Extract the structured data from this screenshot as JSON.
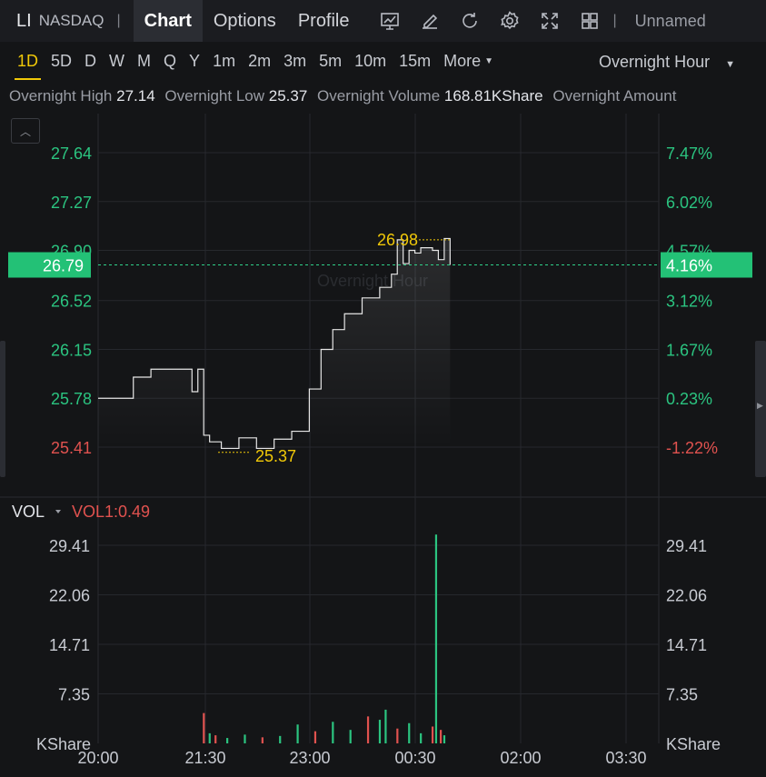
{
  "header": {
    "symbol": "LI",
    "exchange": "NASDAQ",
    "separator": "|",
    "tabs": [
      {
        "label": "Chart",
        "active": true
      },
      {
        "label": "Options",
        "active": false
      },
      {
        "label": "Profile",
        "active": false
      }
    ],
    "icons": [
      "chart-type-icon",
      "draw-pencil-icon",
      "refresh-icon",
      "settings-gear-icon",
      "fullscreen-icon",
      "layout-grid-icon"
    ],
    "layout_name": "Unnamed"
  },
  "periods": {
    "items": [
      "1D",
      "5D",
      "D",
      "W",
      "M",
      "Q",
      "Y",
      "1m",
      "2m",
      "3m",
      "5m",
      "10m",
      "15m",
      "More"
    ],
    "active": "1D",
    "session": "Overnight Hour"
  },
  "stats": {
    "high_label": "Overnight High",
    "high_value": "27.14",
    "low_label": "Overnight Low",
    "low_value": "25.37",
    "volume_label": "Overnight Volume",
    "volume_value": "168.81KShare",
    "amount_label": "Overnight Amount"
  },
  "watermark": "Overnight Hour",
  "colors": {
    "up": "#2bc480",
    "down": "#e0524f",
    "accent": "#f0c808",
    "current_price_bg": "#23c176",
    "price_line": "#e6e6e6"
  },
  "chart_data": [
    {
      "type": "line",
      "title": "",
      "x_labels": [
        "20:00",
        "21:30",
        "23:00",
        "00:30",
        "02:00",
        "03:30"
      ],
      "y_left_ticks": [
        "27.64",
        "27.27",
        "26.90",
        "26.52",
        "26.15",
        "25.78",
        "25.41"
      ],
      "y_right_ticks": [
        "7.47%",
        "6.02%",
        "4.57%",
        "3.12%",
        "1.67%",
        "0.23%",
        "-1.22%"
      ],
      "ylim": [
        25.41,
        27.64
      ],
      "current_price": "26.79",
      "current_change": "4.16%",
      "max_marker": "26.98",
      "min_marker": "25.37",
      "series": [
        {
          "x": [
            "20:00",
            "20:15",
            "20:30",
            "20:45",
            "21:00",
            "21:15",
            "21:20",
            "21:25",
            "21:30",
            "21:35",
            "21:45",
            "22:00",
            "22:15",
            "22:30",
            "22:45",
            "23:00",
            "23:10",
            "23:20",
            "23:30",
            "23:45",
            "00:00",
            "00:10",
            "00:15",
            "00:20",
            "00:25",
            "00:30",
            "00:35",
            "00:45",
            "00:50",
            "00:55",
            "01:00"
          ],
          "y": [
            25.78,
            25.78,
            25.94,
            26.0,
            26.0,
            26.0,
            25.83,
            26.0,
            25.5,
            25.45,
            25.4,
            25.48,
            25.4,
            25.47,
            25.53,
            25.85,
            26.15,
            26.3,
            26.42,
            26.54,
            26.62,
            26.72,
            26.98,
            26.8,
            26.9,
            26.88,
            26.92,
            26.9,
            26.83,
            26.99,
            26.79
          ]
        }
      ]
    },
    {
      "type": "bar",
      "title": "",
      "legend_label": "VOL",
      "indicator": "VOL1:0.49",
      "unit": "KShare",
      "y_ticks": [
        "29.41",
        "22.06",
        "14.71",
        "7.35"
      ],
      "ylim": [
        0,
        32.0
      ],
      "x": [
        "21:30",
        "21:35",
        "21:40",
        "21:50",
        "22:05",
        "22:20",
        "22:35",
        "22:50",
        "23:05",
        "23:20",
        "23:35",
        "23:50",
        "00:00",
        "00:05",
        "00:15",
        "00:25",
        "00:35",
        "00:45",
        "00:48",
        "00:52",
        "00:55"
      ],
      "values": [
        4.5,
        1.5,
        1.2,
        0.8,
        1.3,
        0.9,
        1.1,
        2.8,
        1.8,
        3.2,
        2.0,
        4.0,
        3.5,
        5.0,
        2.2,
        3.0,
        1.5,
        2.5,
        31.0,
        2.0,
        1.2
      ],
      "up": [
        false,
        true,
        false,
        true,
        true,
        false,
        true,
        true,
        false,
        true,
        true,
        false,
        true,
        true,
        false,
        true,
        true,
        false,
        true,
        false,
        true
      ]
    }
  ]
}
